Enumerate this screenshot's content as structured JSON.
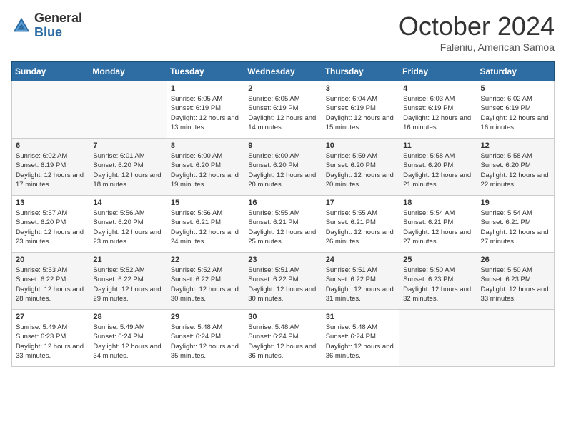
{
  "logo": {
    "general": "General",
    "blue": "Blue"
  },
  "title": "October 2024",
  "location": "Faleniu, American Samoa",
  "days_of_week": [
    "Sunday",
    "Monday",
    "Tuesday",
    "Wednesday",
    "Thursday",
    "Friday",
    "Saturday"
  ],
  "weeks": [
    [
      {
        "day": "",
        "info": ""
      },
      {
        "day": "",
        "info": ""
      },
      {
        "day": "1",
        "info": "Sunrise: 6:05 AM\nSunset: 6:19 PM\nDaylight: 12 hours and 13 minutes."
      },
      {
        "day": "2",
        "info": "Sunrise: 6:05 AM\nSunset: 6:19 PM\nDaylight: 12 hours and 14 minutes."
      },
      {
        "day": "3",
        "info": "Sunrise: 6:04 AM\nSunset: 6:19 PM\nDaylight: 12 hours and 15 minutes."
      },
      {
        "day": "4",
        "info": "Sunrise: 6:03 AM\nSunset: 6:19 PM\nDaylight: 12 hours and 16 minutes."
      },
      {
        "day": "5",
        "info": "Sunrise: 6:02 AM\nSunset: 6:19 PM\nDaylight: 12 hours and 16 minutes."
      }
    ],
    [
      {
        "day": "6",
        "info": "Sunrise: 6:02 AM\nSunset: 6:19 PM\nDaylight: 12 hours and 17 minutes."
      },
      {
        "day": "7",
        "info": "Sunrise: 6:01 AM\nSunset: 6:20 PM\nDaylight: 12 hours and 18 minutes."
      },
      {
        "day": "8",
        "info": "Sunrise: 6:00 AM\nSunset: 6:20 PM\nDaylight: 12 hours and 19 minutes."
      },
      {
        "day": "9",
        "info": "Sunrise: 6:00 AM\nSunset: 6:20 PM\nDaylight: 12 hours and 20 minutes."
      },
      {
        "day": "10",
        "info": "Sunrise: 5:59 AM\nSunset: 6:20 PM\nDaylight: 12 hours and 20 minutes."
      },
      {
        "day": "11",
        "info": "Sunrise: 5:58 AM\nSunset: 6:20 PM\nDaylight: 12 hours and 21 minutes."
      },
      {
        "day": "12",
        "info": "Sunrise: 5:58 AM\nSunset: 6:20 PM\nDaylight: 12 hours and 22 minutes."
      }
    ],
    [
      {
        "day": "13",
        "info": "Sunrise: 5:57 AM\nSunset: 6:20 PM\nDaylight: 12 hours and 23 minutes."
      },
      {
        "day": "14",
        "info": "Sunrise: 5:56 AM\nSunset: 6:20 PM\nDaylight: 12 hours and 23 minutes."
      },
      {
        "day": "15",
        "info": "Sunrise: 5:56 AM\nSunset: 6:21 PM\nDaylight: 12 hours and 24 minutes."
      },
      {
        "day": "16",
        "info": "Sunrise: 5:55 AM\nSunset: 6:21 PM\nDaylight: 12 hours and 25 minutes."
      },
      {
        "day": "17",
        "info": "Sunrise: 5:55 AM\nSunset: 6:21 PM\nDaylight: 12 hours and 26 minutes."
      },
      {
        "day": "18",
        "info": "Sunrise: 5:54 AM\nSunset: 6:21 PM\nDaylight: 12 hours and 27 minutes."
      },
      {
        "day": "19",
        "info": "Sunrise: 5:54 AM\nSunset: 6:21 PM\nDaylight: 12 hours and 27 minutes."
      }
    ],
    [
      {
        "day": "20",
        "info": "Sunrise: 5:53 AM\nSunset: 6:22 PM\nDaylight: 12 hours and 28 minutes."
      },
      {
        "day": "21",
        "info": "Sunrise: 5:52 AM\nSunset: 6:22 PM\nDaylight: 12 hours and 29 minutes."
      },
      {
        "day": "22",
        "info": "Sunrise: 5:52 AM\nSunset: 6:22 PM\nDaylight: 12 hours and 30 minutes."
      },
      {
        "day": "23",
        "info": "Sunrise: 5:51 AM\nSunset: 6:22 PM\nDaylight: 12 hours and 30 minutes."
      },
      {
        "day": "24",
        "info": "Sunrise: 5:51 AM\nSunset: 6:22 PM\nDaylight: 12 hours and 31 minutes."
      },
      {
        "day": "25",
        "info": "Sunrise: 5:50 AM\nSunset: 6:23 PM\nDaylight: 12 hours and 32 minutes."
      },
      {
        "day": "26",
        "info": "Sunrise: 5:50 AM\nSunset: 6:23 PM\nDaylight: 12 hours and 33 minutes."
      }
    ],
    [
      {
        "day": "27",
        "info": "Sunrise: 5:49 AM\nSunset: 6:23 PM\nDaylight: 12 hours and 33 minutes."
      },
      {
        "day": "28",
        "info": "Sunrise: 5:49 AM\nSunset: 6:24 PM\nDaylight: 12 hours and 34 minutes."
      },
      {
        "day": "29",
        "info": "Sunrise: 5:48 AM\nSunset: 6:24 PM\nDaylight: 12 hours and 35 minutes."
      },
      {
        "day": "30",
        "info": "Sunrise: 5:48 AM\nSunset: 6:24 PM\nDaylight: 12 hours and 36 minutes."
      },
      {
        "day": "31",
        "info": "Sunrise: 5:48 AM\nSunset: 6:24 PM\nDaylight: 12 hours and 36 minutes."
      },
      {
        "day": "",
        "info": ""
      },
      {
        "day": "",
        "info": ""
      }
    ]
  ]
}
